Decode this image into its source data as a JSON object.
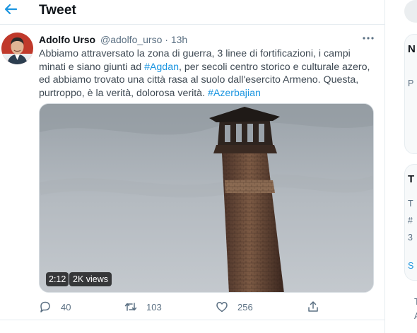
{
  "header": {
    "title": "Tweet",
    "back_icon": "arrow-left-icon"
  },
  "tweet": {
    "author_name": "Adolfo Urso",
    "author_handle": "@adolfo_urso",
    "separator": "·",
    "time": "13h",
    "more_icon": "more-dots-icon",
    "text": {
      "part1": "Abbiamo attraversato la zona di guerra, 3 linee di fortificazioni, i campi minati e siano giunti ad ",
      "hashtag1": "#Agdan",
      "part2": ", per secoli centro storico e culturale azero, ed abbiamo trovato una città rasa al suolo dall'esercito Armeno. Questa, purtroppo, è la verità, dolorosa verità. ",
      "hashtag2": "#Azerbajian"
    },
    "video": {
      "duration": "2:12",
      "views": "2K views"
    },
    "actions": {
      "reply_count": "40",
      "retweet_count": "103",
      "like_count": "256"
    }
  },
  "sidebar": {
    "card1_fragments": [
      "N",
      "P"
    ],
    "card2_fragments": [
      "T",
      "T",
      "#",
      "3",
      "S"
    ],
    "footer_fragments": [
      "T",
      "A"
    ]
  },
  "colors": {
    "accent": "#1b95e0",
    "secondary_text": "#5b7083",
    "border": "#e6ecf0"
  }
}
